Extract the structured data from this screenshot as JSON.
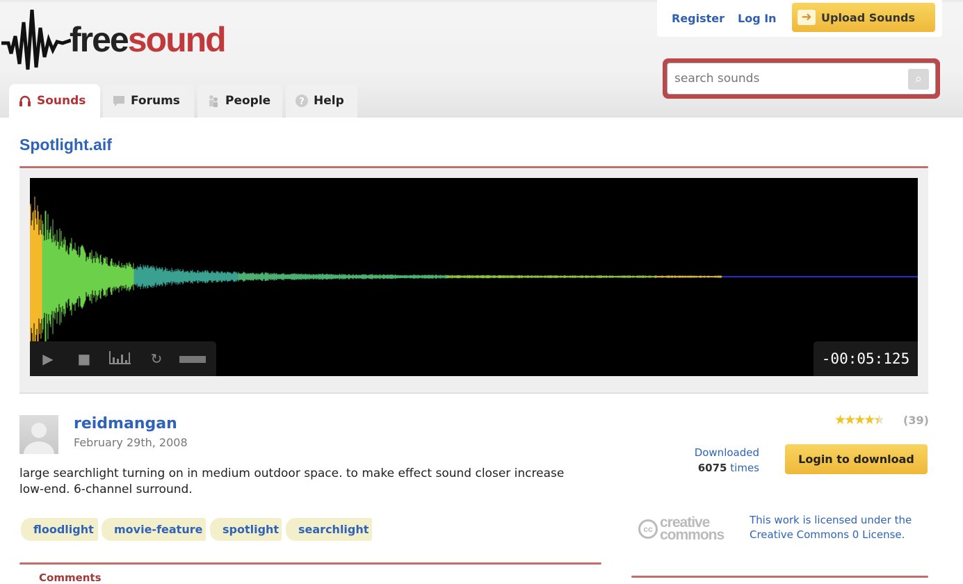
{
  "brand": {
    "part1": "free",
    "part2": "sound"
  },
  "nav": {
    "tabs": [
      {
        "label": "Sounds",
        "icon": "headphones-icon"
      },
      {
        "label": "Forums",
        "icon": "speech-bubble-icon"
      },
      {
        "label": "People",
        "icon": "people-icon"
      },
      {
        "label": "Help",
        "icon": "help-icon"
      }
    ]
  },
  "account": {
    "register": "Register",
    "login": "Log In",
    "upload": "Upload Sounds"
  },
  "search": {
    "placeholder": "search sounds",
    "value": ""
  },
  "sound": {
    "title": "Spotlight.aif",
    "timer": "-00:05:125",
    "author": "reidmangan",
    "date": "February 29th, 2008",
    "description": "large searchlight turning on in medium outdoor space. to make effect sound closer increase low-end. 6-channel surround.",
    "tags": [
      "floodlight",
      "movie-feature",
      "spotlight",
      "searchlight"
    ],
    "rating": 4.5,
    "rating_count": "(39)",
    "downloaded_label": "Downloaded",
    "downloads": "6075",
    "times_label": "times",
    "login_download": "Login to download",
    "license": "This work is licensed under the Creative Commons 0 License.",
    "cc_logo": "creative commons",
    "played_fraction": 0.78
  },
  "comments_label": "Comments",
  "colors": {
    "accent": "#c0393b",
    "link": "#2f63b8",
    "button": "#f4c94a"
  }
}
